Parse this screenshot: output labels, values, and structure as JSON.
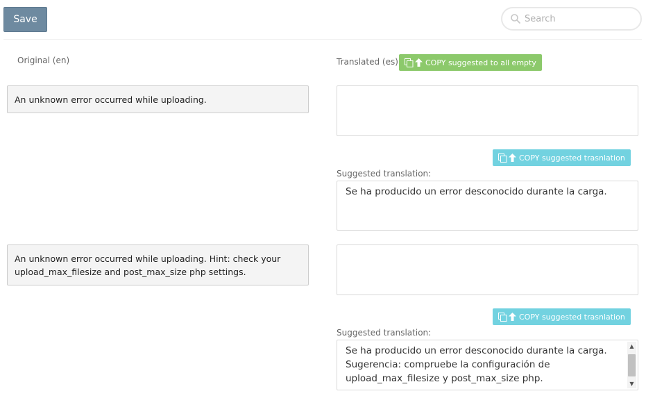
{
  "toolbar": {
    "save_label": "Save",
    "search_placeholder": "Search"
  },
  "headers": {
    "original_label": "Original (en)",
    "translated_label": "Translated (es)",
    "copy_all_label": "COPY suggested to all empty"
  },
  "entries": [
    {
      "original": "An unknown error occurred while uploading.",
      "translation": "",
      "copy_suggested_label": "COPY suggested trasnlation",
      "suggested_label": "Suggested translation:",
      "suggested": "Se ha producido un error desconocido durante la carga."
    },
    {
      "original": "An unknown error occurred while uploading. Hint: check your upload_max_filesize and post_max_size php settings.",
      "translation": "",
      "copy_suggested_label": "COPY suggested trasnlation",
      "suggested_label": "Suggested translation:",
      "suggested": "Se ha producido un error desconocido durante la carga. Sugerencia: compruebe la configuración de upload_max_filesize y post_max_size php."
    }
  ],
  "colors": {
    "save_button": "#6e8aa0",
    "copy_all_button": "#8cc96b",
    "copy_suggested_button": "#72d2e0"
  },
  "icons": {
    "search": "search-icon",
    "copy": "copy-icon",
    "arrow_up": "arrow-up-icon"
  }
}
